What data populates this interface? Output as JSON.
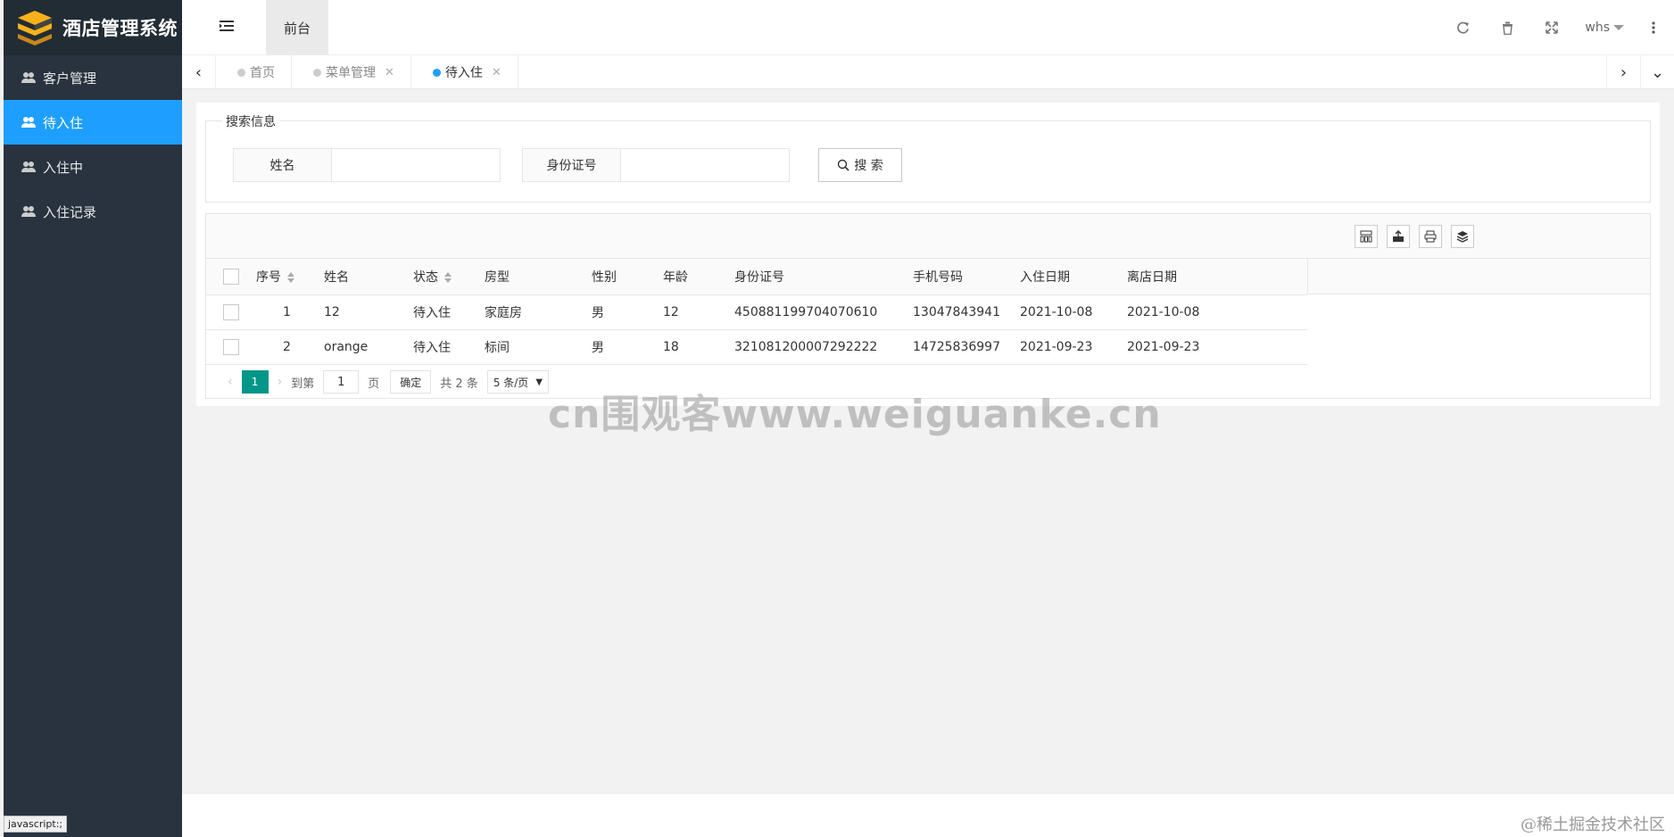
{
  "app": {
    "title": "酒店管理系统"
  },
  "sidebar": {
    "items": [
      {
        "label": "客户管理",
        "active": false
      },
      {
        "label": "待入住",
        "active": true
      },
      {
        "label": "入住中",
        "active": false
      },
      {
        "label": "入住记录",
        "active": false
      }
    ]
  },
  "header": {
    "front_tab": "前台",
    "user": "whs"
  },
  "tabs": [
    {
      "label": "首页",
      "closable": false,
      "active": false
    },
    {
      "label": "菜单管理",
      "closable": true,
      "active": false
    },
    {
      "label": "待入住",
      "closable": true,
      "active": true
    }
  ],
  "search": {
    "legend": "搜索信息",
    "name_label": "姓名",
    "name_value": "",
    "id_label": "身份证号",
    "id_value": "",
    "button_label": "搜 索"
  },
  "table": {
    "columns": [
      "序号",
      "姓名",
      "状态",
      "房型",
      "性别",
      "年龄",
      "身份证号",
      "手机号码",
      "入住日期",
      "离店日期"
    ],
    "rows": [
      [
        "1",
        "12",
        "待入住",
        "家庭房",
        "男",
        "12",
        "450881199704070610",
        "13047843941",
        "2021-10-08",
        "2021-10-08"
      ],
      [
        "2",
        "orange",
        "待入住",
        "标间",
        "男",
        "18",
        "321081200007292222",
        "14725836997",
        "2021-09-23",
        "2021-09-23"
      ]
    ]
  },
  "pager": {
    "current": "1",
    "goto_label": "到第",
    "goto_value": "1",
    "page_unit": "页",
    "confirm": "确定",
    "total": "共 2 条",
    "page_size": "5 条/页"
  },
  "watermark": "cn围观客www.weiguanke.cn",
  "status_tip": "javascript:;",
  "corner_mark": "@稀土掘金技术社区",
  "colors": {
    "sidebar_bg": "#28333f",
    "active_nav": "#1e9fff",
    "pager_active": "#009688"
  }
}
